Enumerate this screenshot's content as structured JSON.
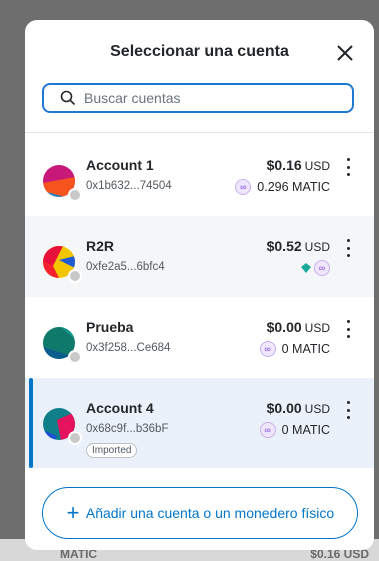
{
  "modal": {
    "title": "Seleccionar una cuenta",
    "search_placeholder": "Buscar cuentas",
    "add_button_label": "Añadir una cuenta o un monedero físico"
  },
  "accounts": [
    {
      "name": "Account 1",
      "address": "0x1b632...74504",
      "balance": "$0.16",
      "currency": "USD",
      "token_amount": "0.296 MATIC",
      "badge": ""
    },
    {
      "name": "R2R",
      "address": "0xfe2a5...6bfc4",
      "balance": "$0.52",
      "currency": "USD",
      "token_amount": "",
      "badge": ""
    },
    {
      "name": "Prueba",
      "address": "0x3f258...Ce684",
      "balance": "$0.00",
      "currency": "USD",
      "token_amount": "0 MATIC",
      "badge": ""
    },
    {
      "name": "Account 4",
      "address": "0x68c9f...b36bF",
      "balance": "$0.00",
      "currency": "USD",
      "token_amount": "0 MATIC",
      "badge": "Imported",
      "selected": true
    }
  ],
  "backdrop": {
    "left_text": "MATIC",
    "right_text": "$0.16 USD"
  },
  "colors": {
    "accent": "#0376c9",
    "matic": "#8247e5"
  },
  "icons": {
    "close": "close-icon",
    "search": "search-icon",
    "menu": "kebab-menu-icon",
    "token": "matic-token-icon",
    "add": "plus-icon"
  }
}
